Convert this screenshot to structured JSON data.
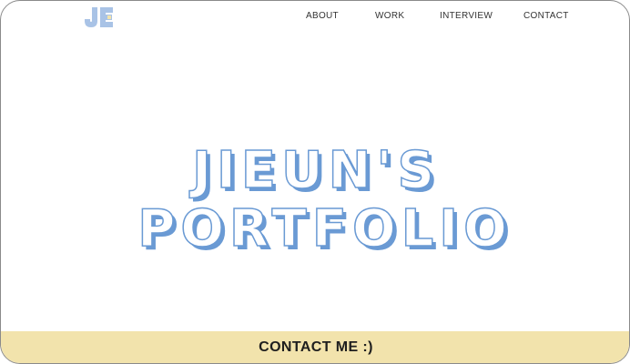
{
  "logo": {
    "text": "JE"
  },
  "nav": {
    "items": [
      {
        "label": "ABOUT"
      },
      {
        "label": "WORK"
      },
      {
        "label": "INTERVIEW"
      },
      {
        "label": "CONTACT"
      }
    ]
  },
  "hero": {
    "title_line1": "JIEUN'S",
    "title_line2": "PORTFOLIO"
  },
  "footer": {
    "label": "CONTACT ME :)"
  },
  "colors": {
    "accent_blue": "#6a9ad4",
    "light_blue": "#a9c3e6",
    "footer_bg": "#f2e3ac",
    "text_dark": "#1e1e1e"
  }
}
